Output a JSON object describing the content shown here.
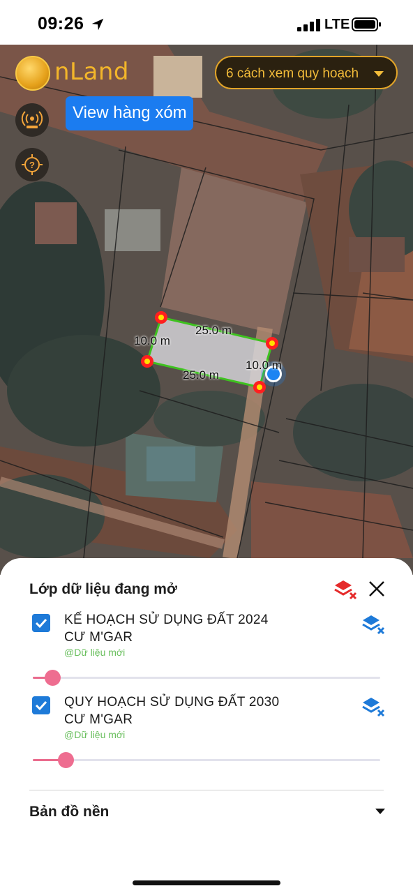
{
  "status_bar": {
    "time": "09:26",
    "network": "LTE",
    "signal_bars": 4
  },
  "map": {
    "logo_text": "nLand",
    "plan_button": "6 cách xem quy hoạch",
    "neighbor_button": "View hàng xóm",
    "parcel": {
      "edges": {
        "top": "25.0 m",
        "bottom": "25.0 m",
        "left": "10.0 m",
        "right": "10.0 m"
      }
    },
    "colors": {
      "parcel_outline": "#3ec21f",
      "vertex": "#ff1f1f",
      "vertex_center": "#ffe100",
      "location": "#1d84f2"
    },
    "icons": [
      "antenna-icon",
      "help-location-icon"
    ]
  },
  "sheet": {
    "title": "Lớp dữ liệu đang mở",
    "layers": [
      {
        "name_line1": "KẾ HOẠCH SỬ DỤNG ĐẤT 2024",
        "name_line2": "CƯ M'GAR",
        "source": "@Dữ liệu mới",
        "checked": true,
        "opacity": 0.06
      },
      {
        "name_line1": "QUY HOẠCH SỬ DỤNG ĐẤT 2030",
        "name_line2": "CƯ M'GAR",
        "source": "@Dữ liệu mới",
        "checked": true,
        "opacity": 0.1
      }
    ],
    "basemap_label": "Bản đồ nền"
  }
}
